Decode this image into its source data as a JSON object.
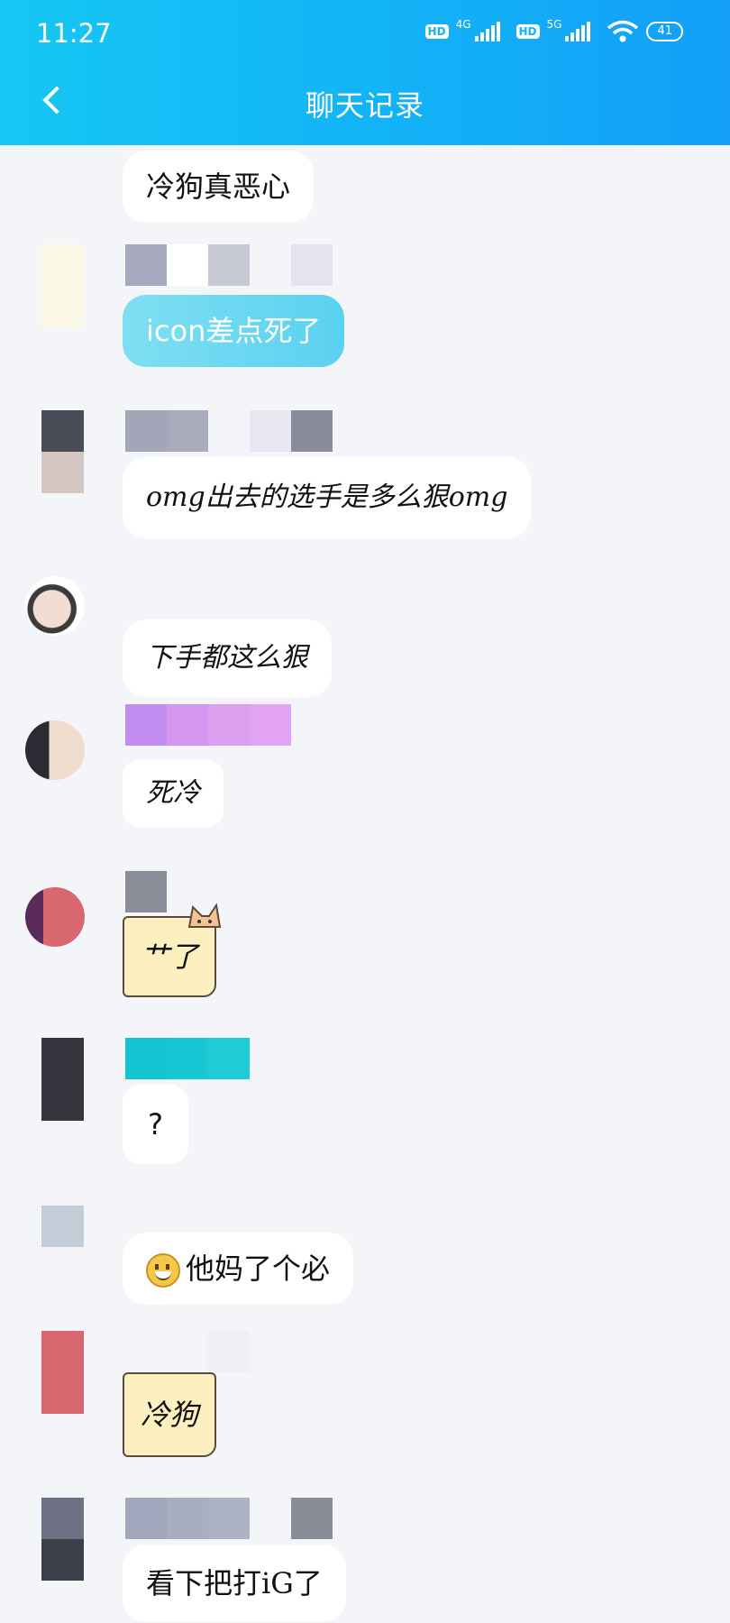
{
  "status_bar": {
    "time": "11:27",
    "hd_label": "HD",
    "net1": "4G",
    "net2": "5G",
    "battery": "41"
  },
  "header": {
    "title": "聊天记录"
  },
  "messages": [
    {
      "text": "冷狗真恶心"
    },
    {
      "text": "icon差点死了"
    },
    {
      "text": "omg出去的选手是多么狠omg"
    },
    {
      "text": "下手都这么狠"
    },
    {
      "text": "死冷"
    },
    {
      "text": "艹了"
    },
    {
      "text": "?"
    },
    {
      "text": "他妈了个必"
    },
    {
      "text": "冷狗"
    },
    {
      "text": "看下把打iG了"
    }
  ],
  "colors": {
    "header_start": "#16c7f4",
    "header_end": "#139ff7",
    "background": "#f4f5f9"
  }
}
